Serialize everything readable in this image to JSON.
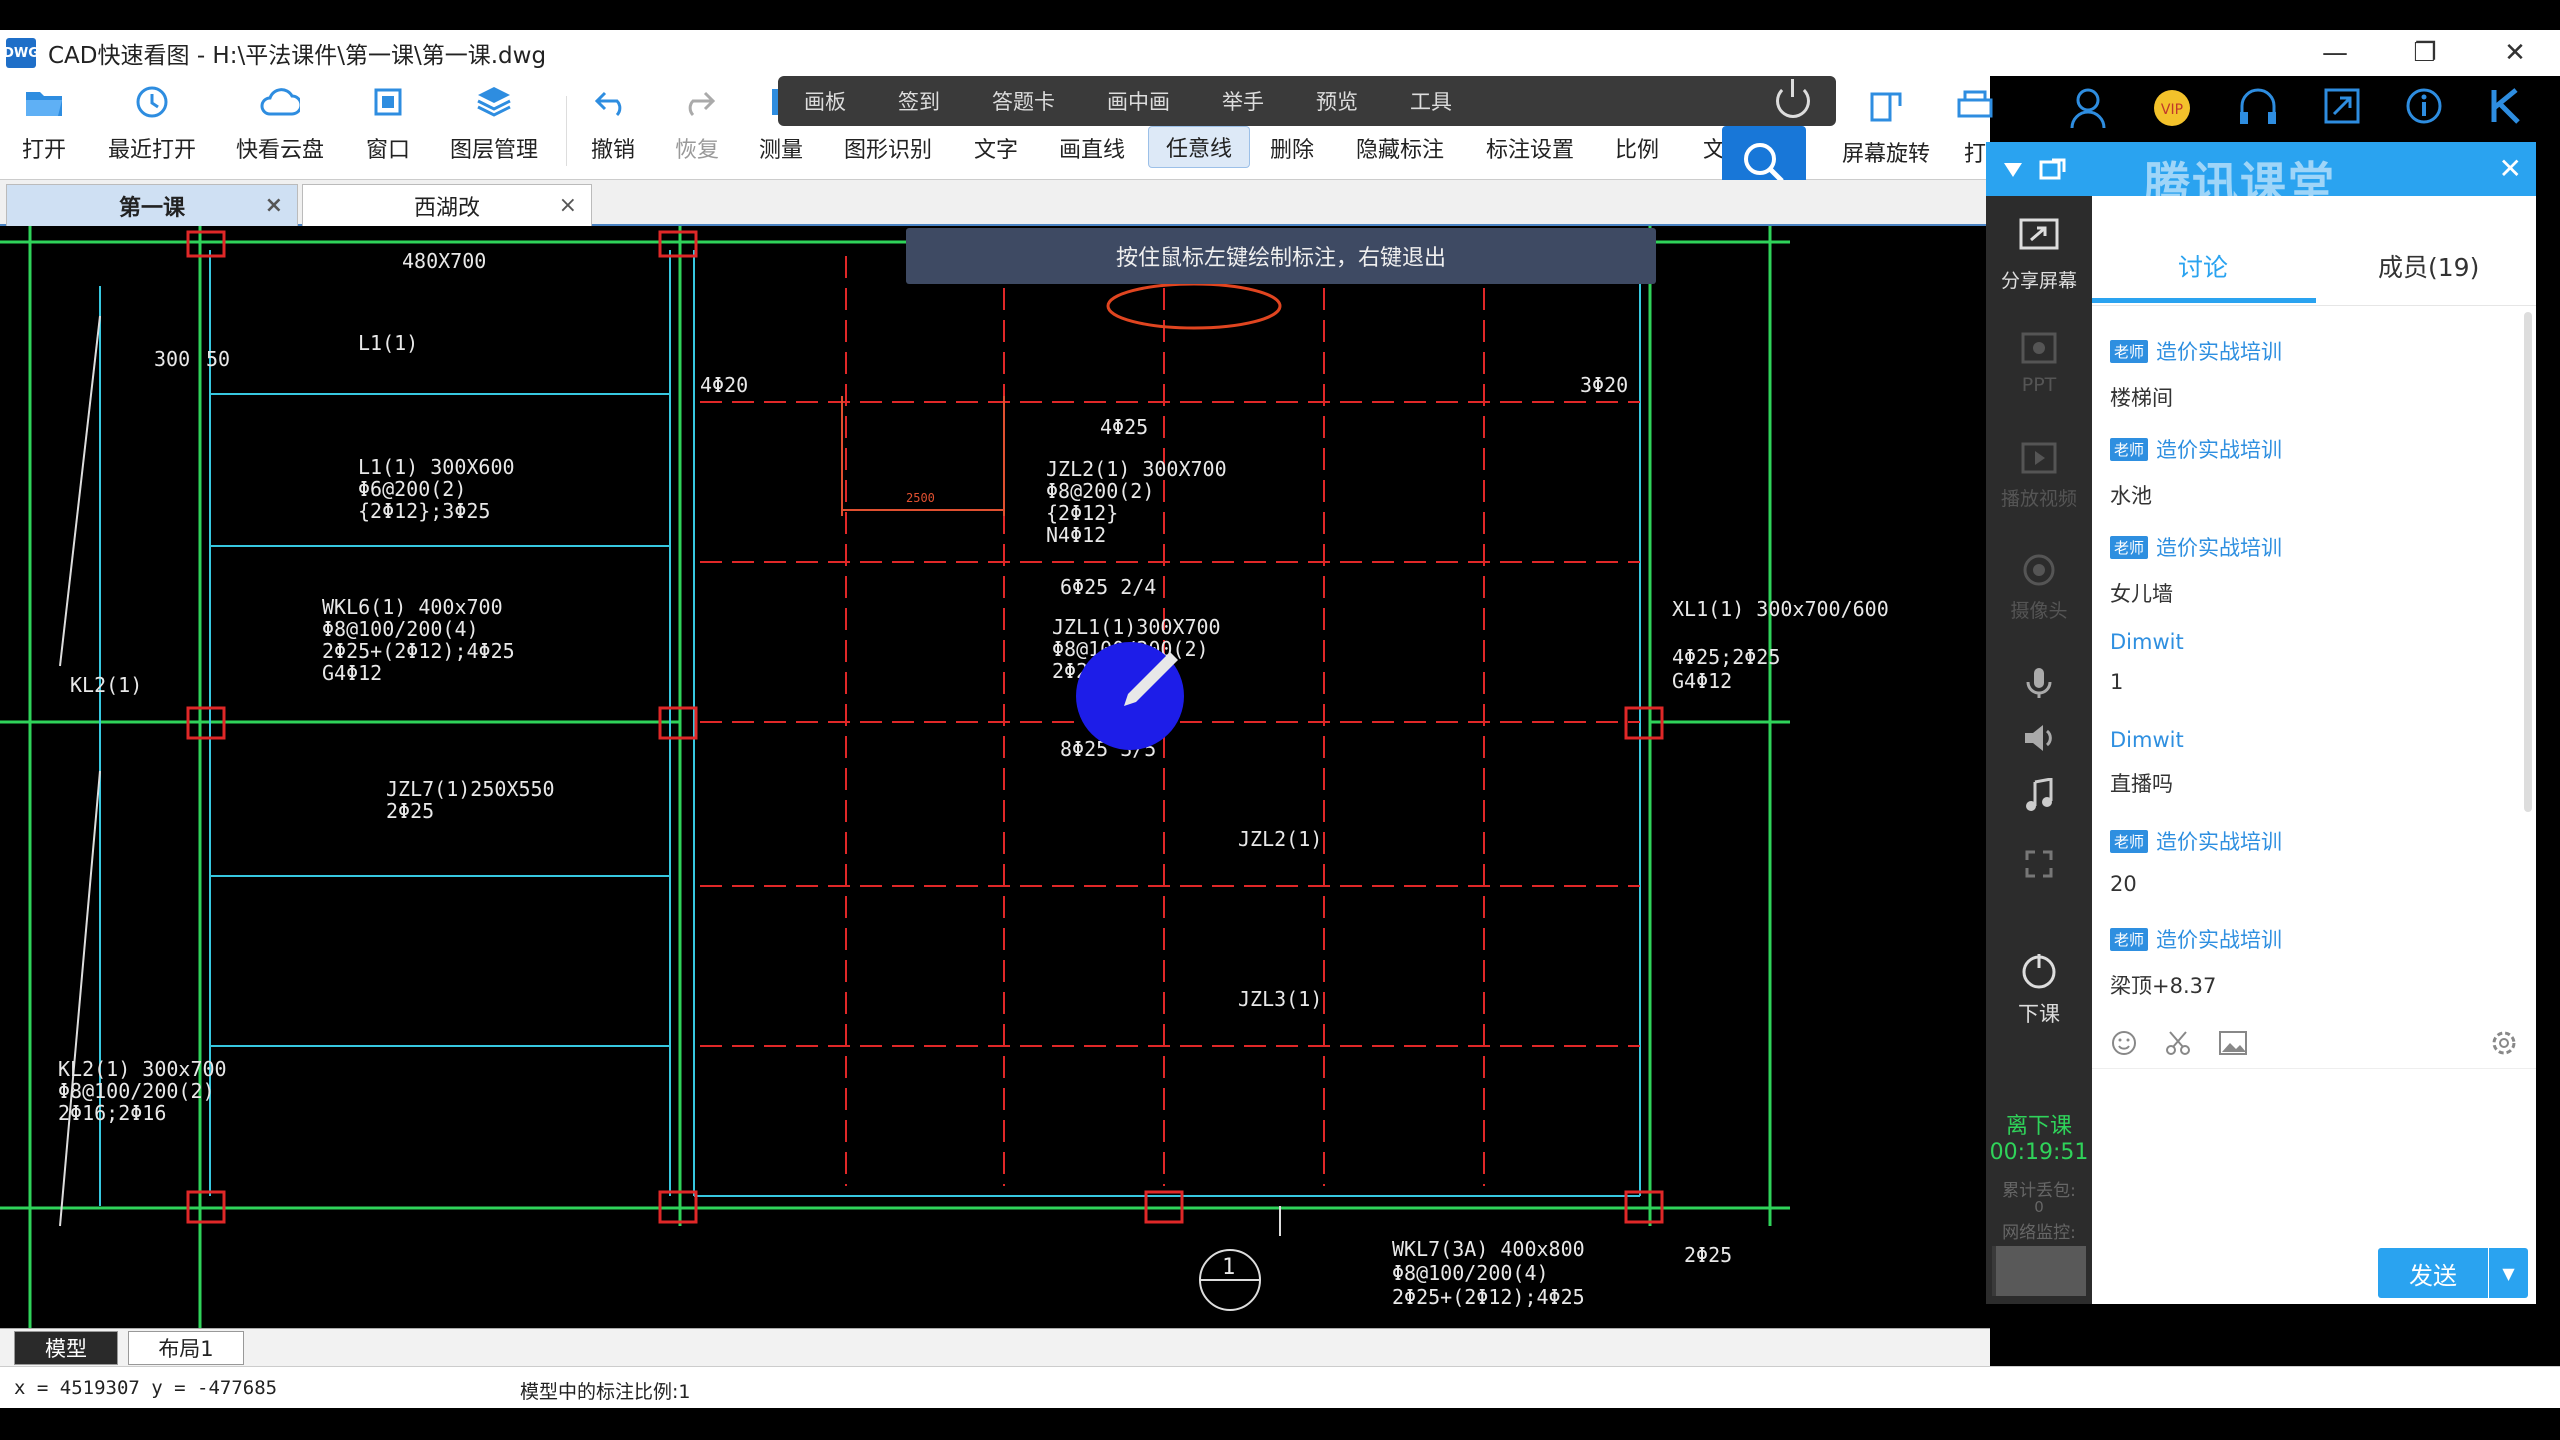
{
  "window": {
    "title": "CAD快速看图 - H:\\平法课件\\第一课\\第一课.dwg",
    "logo": "DWG",
    "controls": [
      "minimize-icon",
      "restore-icon",
      "close-icon"
    ]
  },
  "toolbar": {
    "items": [
      {
        "label": "打开",
        "icon": "folder-open-icon"
      },
      {
        "label": "最近打开",
        "icon": "history-icon"
      },
      {
        "label": "快看云盘",
        "icon": "cloud-icon"
      },
      {
        "label": "窗口",
        "icon": "window-icon"
      },
      {
        "label": "图层管理",
        "icon": "layers-icon"
      },
      {
        "label": "撤销",
        "icon": "undo-icon"
      },
      {
        "label": "恢复",
        "icon": "redo-icon"
      },
      {
        "label": "测量",
        "icon": "measure-icon"
      },
      {
        "label": "图形识别",
        "icon": ""
      },
      {
        "label": "文字",
        "icon": ""
      },
      {
        "label": "画直线",
        "icon": ""
      },
      {
        "label": "任意线",
        "icon": ""
      },
      {
        "label": "删除",
        "icon": ""
      },
      {
        "label": "隐藏标注",
        "icon": ""
      },
      {
        "label": "标注设置",
        "icon": ""
      },
      {
        "label": "比例",
        "icon": ""
      },
      {
        "label": "文",
        "icon": ""
      }
    ],
    "right_items": [
      {
        "label": "屏幕旋转",
        "icon": "rotate-screen-icon"
      },
      {
        "label": "打",
        "icon": "print-icon"
      }
    ],
    "header_icons": [
      "user-icon",
      "vip-icon",
      "headset-icon",
      "expand-icon",
      "info-icon",
      "k-logo-icon"
    ]
  },
  "live_toolbar": {
    "items": [
      "画板",
      "签到",
      "答题卡",
      "画中画",
      "举手",
      "预览",
      "工具"
    ]
  },
  "tabs": [
    {
      "label": "第一课",
      "active": true
    },
    {
      "label": "西湖改",
      "active": false
    }
  ],
  "canvas": {
    "hint": "按住鼠标左键绘制标注，右键退出",
    "annotations": [
      "480X700",
      "300",
      "50",
      "L1(1)",
      "4Φ20",
      "4Φ25",
      "3Φ20",
      "L1(1) 300X600",
      "Φ6@200(2)",
      "{2Φ12};3Φ25",
      "WKL6(1) 400x700",
      "Φ8@100/200(4)",
      "2Φ25+(2Φ12);4Φ25",
      "G4Φ12",
      "JZL2(1) 300X700",
      "Φ8@200(2)",
      "{2Φ12}",
      "N4Φ12",
      "6Φ25 2/4",
      "JZL1(1)300X700",
      "Φ8@100/200(2)",
      "2Φ25",
      "8Φ25 3/5",
      "JZL2(1)",
      "JZL3(1)",
      "JZL7(1)250X550",
      "2Φ25",
      "KL2(1)",
      "XL1(1) 300x700/600",
      "4Φ25;2Φ25",
      "G4Φ12",
      "WKL7(3A) 400x800",
      "Φ8@100/200(4)",
      "2Φ25+(2Φ12);4Φ25",
      "2Φ25",
      "KL2(1) 300x700",
      "Φ8@100/200(2)",
      "2Φ16;2Φ16",
      "2500",
      "1"
    ]
  },
  "layout_tabs": [
    "模型",
    "布局1"
  ],
  "status": {
    "coords": "x = 4519307 y = -477685",
    "scale": "模型中的标注比例:1"
  },
  "classroom": {
    "brand": "腾讯课堂",
    "header_icons": [
      "pin-icon",
      "popout-icon",
      "close-icon"
    ],
    "sidebar": [
      {
        "label": "分享屏幕",
        "icon": "share-screen-icon",
        "dim": false
      },
      {
        "label": "PPT",
        "icon": "ppt-icon",
        "dim": true
      },
      {
        "label": "播放视频",
        "icon": "play-video-icon",
        "dim": true
      },
      {
        "label": "摄像头",
        "icon": "camera-icon",
        "dim": true
      },
      {
        "label": "",
        "icon": "mic-icon",
        "dim": false
      },
      {
        "label": "",
        "icon": "speaker-icon",
        "dim": false
      },
      {
        "label": "",
        "icon": "music-icon",
        "dim": false
      },
      {
        "label": "",
        "icon": "fullscreen-icon",
        "dim": false
      },
      {
        "label": "下课",
        "icon": "end-class-icon",
        "dim": false
      }
    ],
    "class_end_label": "离下课",
    "timer": "00:19:51",
    "stats": [
      "累计丢包:",
      "0",
      "网络监控:"
    ],
    "tabs": [
      "讨论",
      "成员(19)"
    ],
    "messages": [
      {
        "badge": "老师",
        "name": "造价实战培训",
        "text": "楼梯间"
      },
      {
        "badge": "老师",
        "name": "造价实战培训",
        "text": "水池"
      },
      {
        "badge": "老师",
        "name": "造价实战培训",
        "text": "女儿墙"
      },
      {
        "badge": "",
        "name": "Dimwit",
        "text": "1"
      },
      {
        "badge": "",
        "name": "Dimwit",
        "text": "直播吗"
      },
      {
        "badge": "老师",
        "name": "造价实战培训",
        "text": "20"
      },
      {
        "badge": "老师",
        "name": "造价实战培训",
        "text": "梁顶+8.37"
      }
    ],
    "chat_tools": [
      "emoji-icon",
      "scissors-icon",
      "image-icon",
      "settings-icon"
    ],
    "send_label": "发送"
  }
}
